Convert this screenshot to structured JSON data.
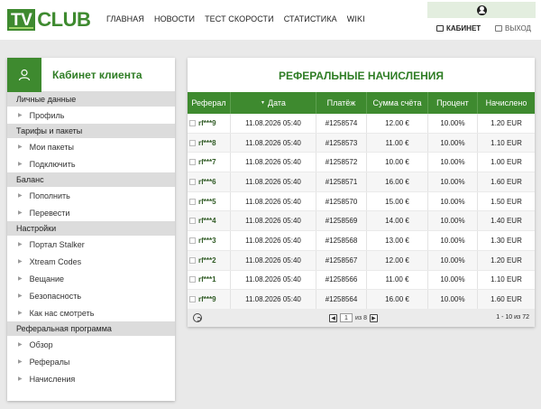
{
  "header": {
    "logo_tv": "TV",
    "logo_club": "CLUB",
    "nav": [
      "ГЛАВНАЯ",
      "НОВОСТИ",
      "ТЕСТ СКОРОСТИ",
      "СТАТИСТИКА",
      "WIKI"
    ],
    "cabinet_label": "КАБИНЕТ",
    "exit_label": "ВЫХОД"
  },
  "sidebar": {
    "title": "Кабинет клиента",
    "sections": [
      {
        "label": "Личные данные",
        "items": [
          "Профиль"
        ]
      },
      {
        "label": "Тарифы и пакеты",
        "items": [
          "Мои пакеты",
          "Подключить"
        ]
      },
      {
        "label": "Баланс",
        "items": [
          "Пополнить",
          "Перевести"
        ]
      },
      {
        "label": "Настройки",
        "items": [
          "Портал Stalker",
          "Xtream Codes",
          "Вещание",
          "Безопасность",
          "Как нас смотреть"
        ]
      },
      {
        "label": "Реферальная программа",
        "items": [
          "Обзор",
          "Рефералы",
          "Начисления"
        ]
      }
    ]
  },
  "panel": {
    "title": "РЕФЕРАЛЬНЫЕ НАЧИСЛЕНИЯ",
    "columns": [
      "Реферал",
      "Дата",
      "Платёж",
      "Сумма счёта",
      "Процент",
      "Начислено"
    ],
    "rows": [
      [
        "rf***9",
        "11.08.2026 05:40",
        "#1258574",
        "12.00 €",
        "10.00%",
        "1.20 EUR"
      ],
      [
        "rf***8",
        "11.08.2026 05:40",
        "#1258573",
        "11.00 €",
        "10.00%",
        "1.10 EUR"
      ],
      [
        "rf***7",
        "11.08.2026 05:40",
        "#1258572",
        "10.00 €",
        "10.00%",
        "1.00 EUR"
      ],
      [
        "rf***6",
        "11.08.2026 05:40",
        "#1258571",
        "16.00 €",
        "10.00%",
        "1.60 EUR"
      ],
      [
        "rf***5",
        "11.08.2026 05:40",
        "#1258570",
        "15.00 €",
        "10.00%",
        "1.50 EUR"
      ],
      [
        "rf***4",
        "11.08.2026 05:40",
        "#1258569",
        "14.00 €",
        "10.00%",
        "1.40 EUR"
      ],
      [
        "rf***3",
        "11.08.2026 05:40",
        "#1258568",
        "13.00 €",
        "10.00%",
        "1.30 EUR"
      ],
      [
        "rf***2",
        "11.08.2026 05:40",
        "#1258567",
        "12.00 €",
        "10.00%",
        "1.20 EUR"
      ],
      [
        "rf***1",
        "11.08.2026 05:40",
        "#1258566",
        "11.00 €",
        "10.00%",
        "1.10 EUR"
      ],
      [
        "rf***9",
        "11.08.2026 05:40",
        "#1258564",
        "16.00 €",
        "10.00%",
        "1.60 EUR"
      ]
    ],
    "pager": {
      "page": "1",
      "of_text": "из 8",
      "count_text": "1 - 10 из 72",
      "prev": "◀",
      "next": "▶"
    }
  },
  "colors": {
    "brand_green": "#3e8a2f",
    "title_green": "#2f7d25"
  }
}
